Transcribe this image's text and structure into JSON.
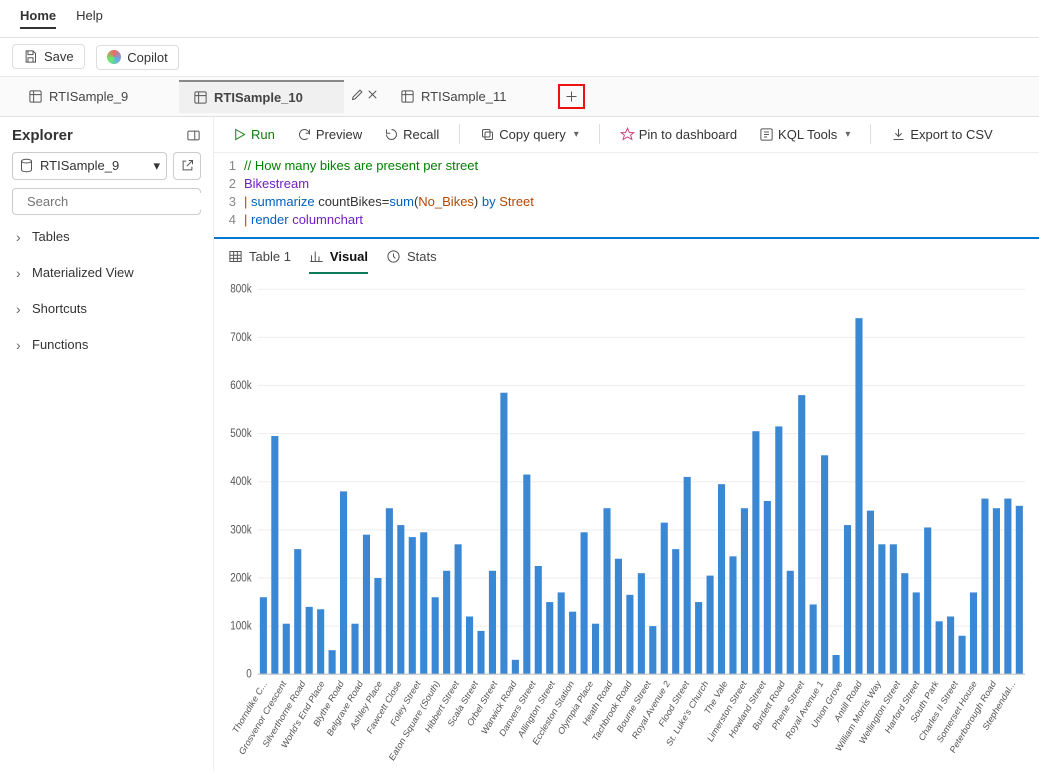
{
  "menu": {
    "home": "Home",
    "help": "Help"
  },
  "topbar": {
    "save": "Save",
    "copilot": "Copilot"
  },
  "tabs": [
    {
      "label": "RTISample_9",
      "active": false
    },
    {
      "label": "RTISample_10",
      "active": true
    },
    {
      "label": "RTISample_11",
      "active": false
    }
  ],
  "explorer": {
    "title": "Explorer",
    "db": "RTISample_9",
    "search_ph": "Search",
    "items": [
      "Tables",
      "Materialized View",
      "Shortcuts",
      "Functions"
    ]
  },
  "actions": {
    "run": "Run",
    "preview": "Preview",
    "recall": "Recall",
    "copy": "Copy query",
    "pin": "Pin to dashboard",
    "tools": "KQL Tools",
    "export": "Export to CSV"
  },
  "editor": {
    "lines": [
      "1",
      "2",
      "3",
      "4"
    ],
    "l1_comment": "// How many bikes are present per street",
    "l2": "Bikestream",
    "l3_pipe": "| ",
    "l3_kw": "summarize ",
    "l3_assign": "countBikes=",
    "l3_fn": "sum",
    "l3_open": "(",
    "l3_arg": "No_Bikes",
    "l3_close": ") ",
    "l3_by": "by ",
    "l3_col": "Street",
    "l4_pipe": "| ",
    "l4_kw": "render ",
    "l4_val": "columnchart"
  },
  "result_tabs": {
    "table": "Table 1",
    "visual": "Visual",
    "stats": "Stats"
  },
  "chart_data": {
    "type": "bar",
    "title": "",
    "xlabel": "",
    "ylabel": "",
    "ylim": [
      0,
      800000
    ],
    "yticks": [
      0,
      100000,
      200000,
      300000,
      400000,
      500000,
      600000,
      700000,
      800000
    ],
    "ytick_labels": [
      "0",
      "100k",
      "200k",
      "300k",
      "400k",
      "500k",
      "600k",
      "700k",
      "800k"
    ],
    "categories": [
      "Thorndike C...",
      "Grosvenor Crescent",
      "Silverthorne Road",
      "World's End Place",
      "Blythe Road",
      "Belgrave Road",
      "Ashley Place",
      "Fawcett Close",
      "Foley Street",
      "Eaton Square (South)",
      "Hibbert Street",
      "Scala Street",
      "Orbel Street",
      "Warwick Road",
      "Danvers Street",
      "Allington Street",
      "Eccleston Station",
      "Olympia Place",
      "Heath Road",
      "Tachbrook Road",
      "Bourne Street",
      "Royal Avenue 2",
      "Flood Street",
      "St. Luke's Church",
      "The Vale",
      "Limerston Street",
      "Howland Street",
      "Burdett Road",
      "Phene Street",
      "Royal Avenue 1",
      "Union Grove",
      "Antill Road",
      "William Morris Way",
      "Wellington Street",
      "Harford Street",
      "South Park",
      "Charles II Street",
      "Somerset House",
      "Peterborough Road",
      "Stephendal..."
    ],
    "values": [
      160000,
      495000,
      105000,
      260000,
      140000,
      135000,
      50000,
      380000,
      105000,
      290000,
      200000,
      345000,
      310000,
      285000,
      295000,
      160000,
      215000,
      270000,
      120000,
      90000,
      215000,
      585000,
      30000,
      415000,
      225000,
      150000,
      170000,
      130000,
      295000,
      105000,
      345000,
      240000,
      165000,
      210000,
      100000,
      315000,
      260000,
      410000,
      150000,
      205000,
      395000,
      245000,
      345000,
      505000,
      360000,
      515000,
      215000,
      580000,
      145000,
      455000,
      40000,
      310000,
      740000,
      340000,
      270000,
      270000,
      210000,
      170000,
      305000,
      110000,
      120000,
      80000,
      170000,
      365000,
      345000,
      365000,
      350000
    ]
  }
}
